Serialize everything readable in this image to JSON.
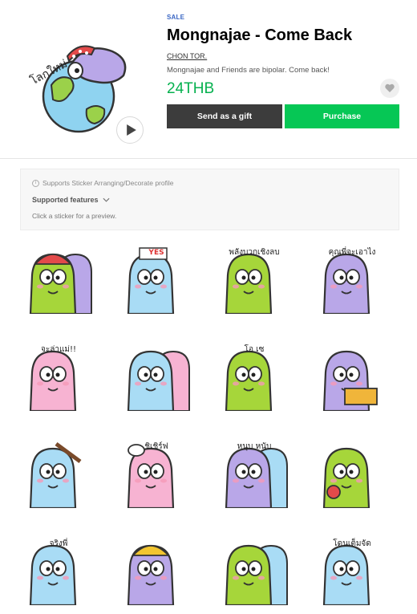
{
  "product": {
    "badge": "SALE",
    "title": "Mongnajae - Come Back",
    "author": "CHON TOR.",
    "description": "Mongnajae and Friends are bipolar. Come back!",
    "price": "24THB",
    "gift_label": "Send as a gift",
    "purchase_label": "Purchase",
    "art_caption": "โลกใหม่"
  },
  "info": {
    "note": "Supports Sticker Arranging/Decorate profile",
    "features_label": "Supported features",
    "hint": "Click a sticker for a preview."
  },
  "colors": {
    "green_char": "#a6d63a",
    "purple_char": "#b9a7e8",
    "blue_char": "#a9dcf5",
    "pink_char": "#f7b3d2",
    "price_green": "#06b14f",
    "buy_green": "#06c755",
    "gift_dark": "#3c3c3c"
  },
  "stickers": [
    {
      "char": "green-purple-hat",
      "caption": ""
    },
    {
      "char": "blue-yes-sign",
      "caption": "YES"
    },
    {
      "char": "green",
      "caption": "พลังบวกเชิงลบ"
    },
    {
      "char": "purple",
      "caption": "คุณพี่จะเอาไง"
    },
    {
      "char": "pink",
      "caption": "จะล่าแม่!!"
    },
    {
      "char": "blue-pink-pair",
      "caption": ""
    },
    {
      "char": "green",
      "caption": "โอ เซ"
    },
    {
      "char": "purple-laptop",
      "caption": ""
    },
    {
      "char": "blue-bat",
      "caption": ""
    },
    {
      "char": "pink-chef",
      "caption": "ชิเชิร์ฟ"
    },
    {
      "char": "purple-blue-pair",
      "caption": "หนุบ หนับ"
    },
    {
      "char": "green-bird",
      "caption": ""
    },
    {
      "char": "blue",
      "caption": "จริงพี่"
    },
    {
      "char": "purple-hat",
      "caption": ""
    },
    {
      "char": "green-blue-pair",
      "caption": ""
    },
    {
      "char": "blue",
      "caption": "โดนเต็มจัด"
    }
  ]
}
